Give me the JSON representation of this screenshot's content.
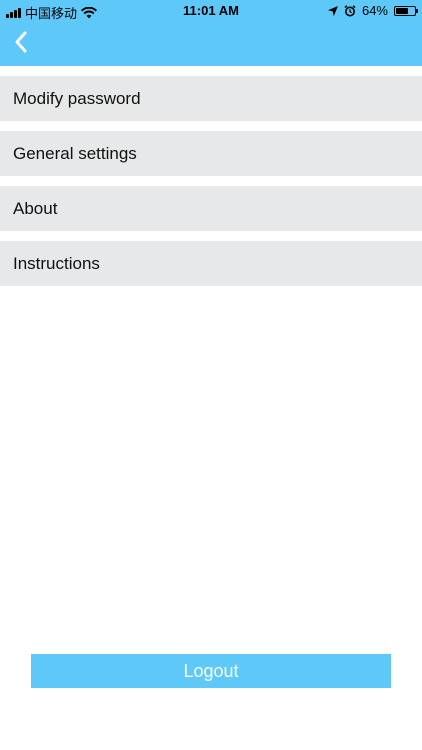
{
  "status_bar": {
    "carrier": "中国移动",
    "time": "11:01 AM",
    "battery_percent": "64%",
    "battery_level": 0.64,
    "icons": [
      "signal-icon",
      "wifi-icon",
      "location-icon",
      "alarm-icon",
      "battery-icon"
    ]
  },
  "header": {
    "back_icon": "chevron-left-icon"
  },
  "menu": {
    "items": [
      {
        "label": "Modify password"
      },
      {
        "label": "General settings"
      },
      {
        "label": "About"
      },
      {
        "label": "Instructions"
      }
    ]
  },
  "footer": {
    "logout_label": "Logout"
  },
  "colors": {
    "accent": "#5ec8f8",
    "item_background": "#e7e8e9",
    "page_background": "#ffffff"
  }
}
